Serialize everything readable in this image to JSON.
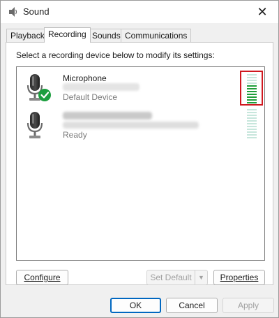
{
  "window": {
    "title": "Sound"
  },
  "tabs": [
    {
      "label": "Playback",
      "active": false
    },
    {
      "label": "Recording",
      "active": true
    },
    {
      "label": "Sounds",
      "active": false
    },
    {
      "label": "Communications",
      "active": false
    }
  ],
  "instruction": "Select a recording device below to modify its settings:",
  "devices": [
    {
      "name": "Microphone",
      "status": "Default Device",
      "is_default": true,
      "level_fraction": 0.6
    },
    {
      "name": "",
      "status": "Ready",
      "is_default": false,
      "level_fraction": 0.0
    }
  ],
  "panel_buttons": {
    "configure": "Configure",
    "set_default": "Set Default",
    "properties": "Properties"
  },
  "dialog_buttons": {
    "ok": "OK",
    "cancel": "Cancel",
    "apply": "Apply"
  },
  "colors": {
    "meter_active": "#1f9e3a",
    "meter_inactive": "#c7e6dc",
    "highlight": "#d0181f",
    "default_check": "#1b9e3e",
    "accent": "#0067c0"
  },
  "icons": {
    "title": "speaker-icon",
    "device": "microphone-icon",
    "default_badge": "checkmark-icon"
  }
}
